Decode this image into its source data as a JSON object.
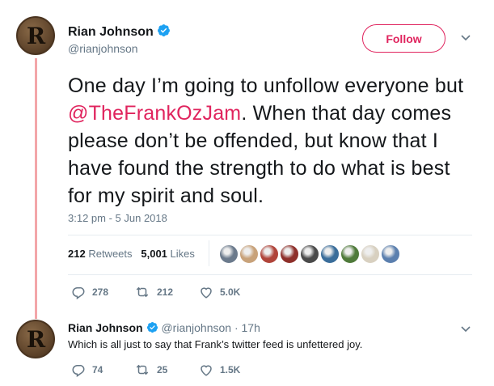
{
  "tweet": {
    "author_name": "Rian Johnson",
    "author_handle": "@rianjohnson",
    "avatar_letter": "R",
    "follow_label": "Follow",
    "text_before": "One day I’m going to unfollow everyone but ",
    "mention": "@TheFrankOzJam",
    "text_after": ". When that day comes please don’t be offended, but know that I have found the strength to do what is best for my spirit and soul.",
    "timestamp": "3:12 pm - 5 Jun 2018",
    "retweets_count": "212",
    "retweets_label": "Retweets",
    "likes_count": "5,001",
    "likes_label": "Likes",
    "liker_avatar_colors": [
      "#6b7a8c",
      "#c8a27a",
      "#b0443a",
      "#8e2f2a",
      "#4a4a4a",
      "#3a6d9a",
      "#4f7a3a",
      "#d8d0c0",
      "#5b7fae"
    ],
    "replies": "278",
    "retweets_short": "212",
    "likes_short": "5.0K"
  },
  "reply": {
    "author_name": "Rian Johnson",
    "author_handle": "@rianjohnson",
    "separator": "·",
    "age": "17h",
    "avatar_letter": "R",
    "text": "Which is all just to say that Frank’s twitter feed is unfettered joy.",
    "replies": "74",
    "retweets": "25",
    "likes": "1.5K"
  },
  "colors": {
    "accent": "#e0245e",
    "verified": "#1da1f2",
    "muted": "#657786",
    "thread_line": "#f3a6a9"
  },
  "icons": [
    "verified-badge-icon",
    "chevron-down-icon",
    "reply-icon",
    "retweet-icon",
    "like-icon"
  ]
}
